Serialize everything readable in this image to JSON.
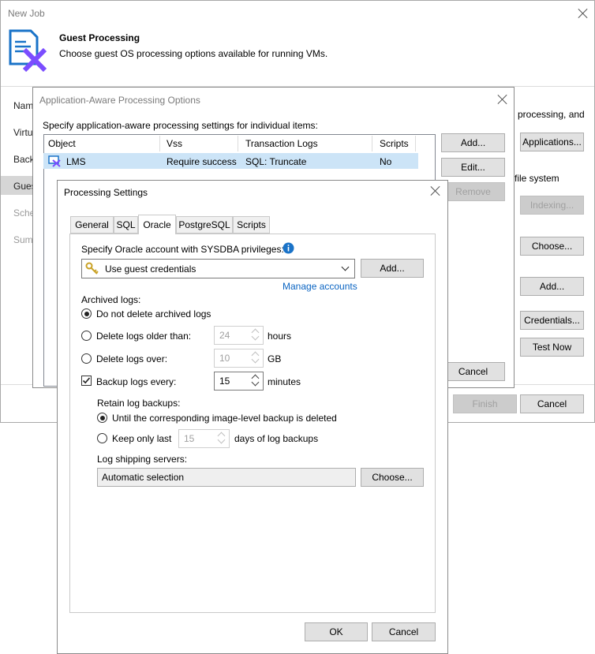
{
  "main_window": {
    "title": "New Job",
    "header_title": "Guest Processing",
    "header_subtitle": "Choose guest OS processing options available for running VMs.",
    "nav": [
      "Nam",
      "Virtu",
      "Back",
      "Gues",
      "Sche",
      "Sumi"
    ],
    "right_text_1": "processing, and",
    "right_text_2": "file system",
    "buttons": {
      "applications": "Applications...",
      "indexing": "Indexing...",
      "choose": "Choose...",
      "add": "Add...",
      "credentials": "Credentials...",
      "test_now": "Test Now",
      "finish": "Finish",
      "cancel": "Cancel"
    }
  },
  "aap_dialog": {
    "title": "Application-Aware Processing Options",
    "instruction": "Specify application-aware processing settings for individual items:",
    "columns": [
      "Object",
      "Vss",
      "Transaction Logs",
      "Scripts"
    ],
    "rows": [
      {
        "object": "LMS",
        "vss": "Require success",
        "logs": "SQL: Truncate",
        "scripts": "No"
      }
    ],
    "buttons": {
      "add": "Add...",
      "edit": "Edit...",
      "remove": "Remove",
      "cancel": "Cancel"
    }
  },
  "processing_settings": {
    "title": "Processing Settings",
    "tabs": [
      "General",
      "SQL",
      "Oracle",
      "PostgreSQL",
      "Scripts"
    ],
    "active_tab": "Oracle",
    "account_label": "Specify Oracle account with SYSDBA privileges:",
    "account_value": "Use guest credentials",
    "add_button": "Add...",
    "manage_accounts": "Manage accounts",
    "archived_logs_label": "Archived logs:",
    "opt_no_delete": "Do not delete archived logs",
    "opt_delete_older": "Delete logs older than:",
    "older_value": "24",
    "older_unit": "hours",
    "opt_delete_over": "Delete logs over:",
    "over_value": "10",
    "over_unit": "GB",
    "backup_logs": "Backup logs every:",
    "backup_value": "15",
    "backup_unit": "minutes",
    "retain_label": "Retain log backups:",
    "retain_until": "Until the corresponding image-level backup is deleted",
    "retain_keep": "Keep only last",
    "keep_value": "15",
    "keep_unit": "days of log backups",
    "shipping_label": "Log shipping servers:",
    "shipping_value": "Automatic selection",
    "choose_button": "Choose...",
    "ok_button": "OK",
    "cancel_button": "Cancel"
  },
  "colors": {
    "accent": "#0a64c2",
    "selected_row": "#cce4f7",
    "info": "#1a73c8"
  }
}
